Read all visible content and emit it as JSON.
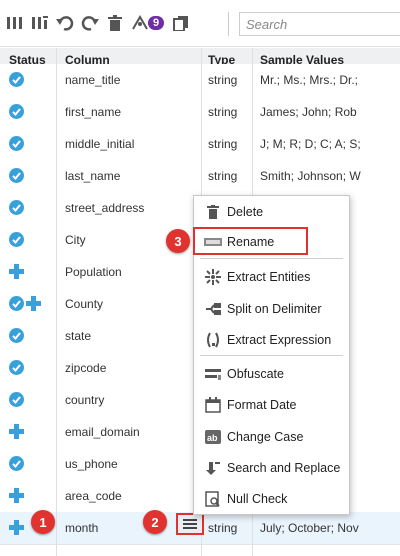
{
  "toolbar": {
    "badge_count": "9",
    "search_placeholder": "Search"
  },
  "table": {
    "headers": {
      "status": "Status",
      "column": "Column",
      "type": "Type",
      "sample": "Sample Values"
    },
    "rows": [
      {
        "status": [
          "ok"
        ],
        "name": "name_title",
        "type": "string",
        "sample": "Mr.; Ms.; Mrs.; Dr.;"
      },
      {
        "status": [
          "ok"
        ],
        "name": "first_name",
        "type": "string",
        "sample": "James; John; Rob"
      },
      {
        "status": [
          "ok"
        ],
        "name": "middle_initial",
        "type": "string",
        "sample": "J; M; R; D; C; A; S;"
      },
      {
        "status": [
          "ok"
        ],
        "name": "last_name",
        "type": "string",
        "sample": "Smith; Johnson; W"
      },
      {
        "status": [
          "ok"
        ],
        "name": "street_address",
        "type": "",
        "sample": "ve"
      },
      {
        "status": [
          "ok"
        ],
        "name": "City",
        "type": "",
        "sample": "n"
      },
      {
        "status": [
          "plus"
        ],
        "name": "Population",
        "type": "",
        "sample": ""
      },
      {
        "status": [
          "ok",
          "plus"
        ],
        "name": "County",
        "type": "",
        "sample": "y"
      },
      {
        "status": [
          "ok"
        ],
        "name": "state",
        "type": "",
        "sample": "L;"
      },
      {
        "status": [
          "ok"
        ],
        "name": "zipcode",
        "type": "",
        "sample": "g"
      },
      {
        "status": [
          "ok"
        ],
        "name": "country",
        "type": "",
        "sample": ""
      },
      {
        "status": [
          "plus"
        ],
        "name": "email_domain",
        "type": "",
        "sample": "o"
      },
      {
        "status": [
          "ok"
        ],
        "name": "us_phone",
        "type": "",
        "sample": "6"
      },
      {
        "status": [
          "plus"
        ],
        "name": "area_code",
        "type": "",
        "sample": "1"
      },
      {
        "status": [
          "plus"
        ],
        "name": "month",
        "type": "string",
        "sample": "July; October; Nov"
      }
    ]
  },
  "context_menu": {
    "items": [
      {
        "label": "Delete",
        "icon": "trash-icon"
      },
      {
        "label": "Rename",
        "icon": "rename-icon"
      },
      {
        "label": "Extract Entities",
        "icon": "extract-entities-icon"
      },
      {
        "label": "Split on Delimiter",
        "icon": "split-icon"
      },
      {
        "label": "Extract Expression",
        "icon": "expression-icon"
      },
      {
        "label": "Obfuscate",
        "icon": "obfuscate-icon"
      },
      {
        "label": "Format Date",
        "icon": "calendar-icon"
      },
      {
        "label": "Change Case",
        "icon": "case-icon"
      },
      {
        "label": "Search and Replace",
        "icon": "search-replace-icon"
      },
      {
        "label": "Null Check",
        "icon": "null-check-icon"
      }
    ]
  },
  "callouts": {
    "one": "1",
    "two": "2",
    "three": "3"
  },
  "colors": {
    "accent_blue": "#3aa0dc",
    "callout_red": "#e0322e",
    "badge_purple": "#6f2da8"
  }
}
